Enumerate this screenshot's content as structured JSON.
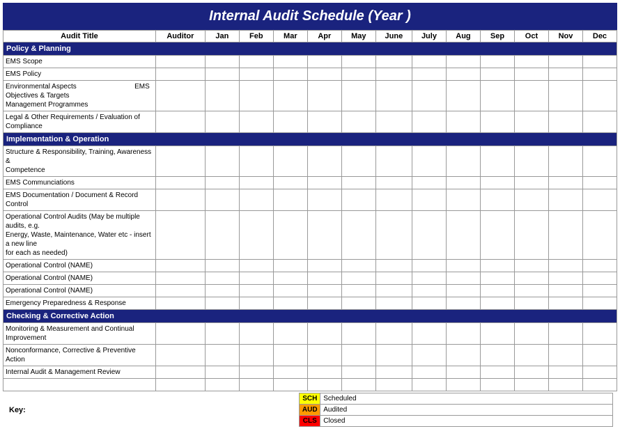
{
  "title": "Internal Audit Schedule (Year                          )",
  "header": {
    "col1": "Audit Title",
    "col2": "Auditor",
    "months": [
      "Jan",
      "Feb",
      "Mar",
      "Apr",
      "May",
      "June",
      "July",
      "Aug",
      "Sep",
      "Oct",
      "Nov",
      "Dec"
    ]
  },
  "sections": [
    {
      "type": "section",
      "label": "Policy & Planning"
    },
    {
      "type": "row",
      "title": "EMS Scope",
      "auditor": ""
    },
    {
      "type": "row",
      "title": "EMS Policy",
      "auditor": ""
    },
    {
      "type": "row",
      "title": "Environmental Aspects                              EMS\nObjectives & Targets\nManagement Programmes",
      "auditor": ""
    },
    {
      "type": "row",
      "title": "Legal & Other Requirements / Evaluation of Compliance",
      "auditor": ""
    },
    {
      "type": "section",
      "label": "Implementation & Operation"
    },
    {
      "type": "row",
      "title": "Structure & Responsibility, Training, Awareness &\nCompetence",
      "auditor": ""
    },
    {
      "type": "row",
      "title": "EMS Communciations",
      "auditor": ""
    },
    {
      "type": "row",
      "title": "EMS Documentation / Document & Record Control",
      "auditor": ""
    },
    {
      "type": "row",
      "title": "Operational Control Audits (May be multiple audits, e.g.\nEnergy, Waste, Maintenance, Water etc - insert a new line\nfor each as needed)",
      "auditor": ""
    },
    {
      "type": "row",
      "title": "Operational Control (NAME)",
      "auditor": ""
    },
    {
      "type": "row",
      "title": "Operational Control (NAME)",
      "auditor": ""
    },
    {
      "type": "row",
      "title": "Operational Control (NAME)",
      "auditor": ""
    },
    {
      "type": "row",
      "title": "Emergency Preparedness & Response",
      "auditor": ""
    },
    {
      "type": "section",
      "label": "Checking & Corrective Action"
    },
    {
      "type": "row",
      "title": "Monitoring & Measurement and Continual Improvement",
      "auditor": ""
    },
    {
      "type": "row",
      "title": "Nonconformance, Corrective & Preventive Action",
      "auditor": ""
    },
    {
      "type": "row",
      "title": "Internal Audit & Management Review",
      "auditor": ""
    },
    {
      "type": "row",
      "title": "",
      "auditor": ""
    }
  ],
  "key": {
    "label": "Key:",
    "items": [
      {
        "color": "#ffff00",
        "text": "Scheduled",
        "abbr": "SCH"
      },
      {
        "color": "#ff9900",
        "text": "Audited",
        "abbr": "AUD"
      },
      {
        "color": "#ff0000",
        "text": "Closed",
        "abbr": "CLS"
      }
    ]
  }
}
